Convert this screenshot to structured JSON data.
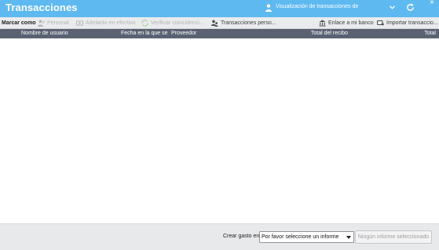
{
  "window": {
    "title": "Transacciones",
    "close_glyph": "×",
    "view_label": "Visualización de transacciones de",
    "icons": [
      "person-icon",
      "chevron-down-icon",
      "refresh-icon"
    ]
  },
  "toolbar": {
    "marcar_label": "Marcar como",
    "personal_label": "Personal",
    "adelanto_label": "Adelanto en efectivo",
    "verificar_label": "Verificar coincidenci...",
    "trans_personales_label": "Transacciones perso...",
    "enlace_label": "Enlace a mi banco",
    "importar_label": "Importar transaccio...",
    "icons": [
      "person-icon",
      "cash-icon",
      "match-icon",
      "users-icon",
      "bank-icon",
      "import-icon"
    ]
  },
  "table": {
    "columns": [
      "Nombre de usuario",
      "Fecha en la que se i",
      "Proveedor",
      "Total del recibo",
      "Total"
    ],
    "rows": []
  },
  "footer": {
    "create_label": "Crear gasto en:",
    "report_select_value": "Por favor seleccione un informe",
    "report_button_label": "Ningún informe seleccionado"
  },
  "colors": {
    "titlebar": "#5fb9f1",
    "toolbar": "#eaebec",
    "table_header": "#5a6272",
    "footer": "#e8e9ea"
  }
}
